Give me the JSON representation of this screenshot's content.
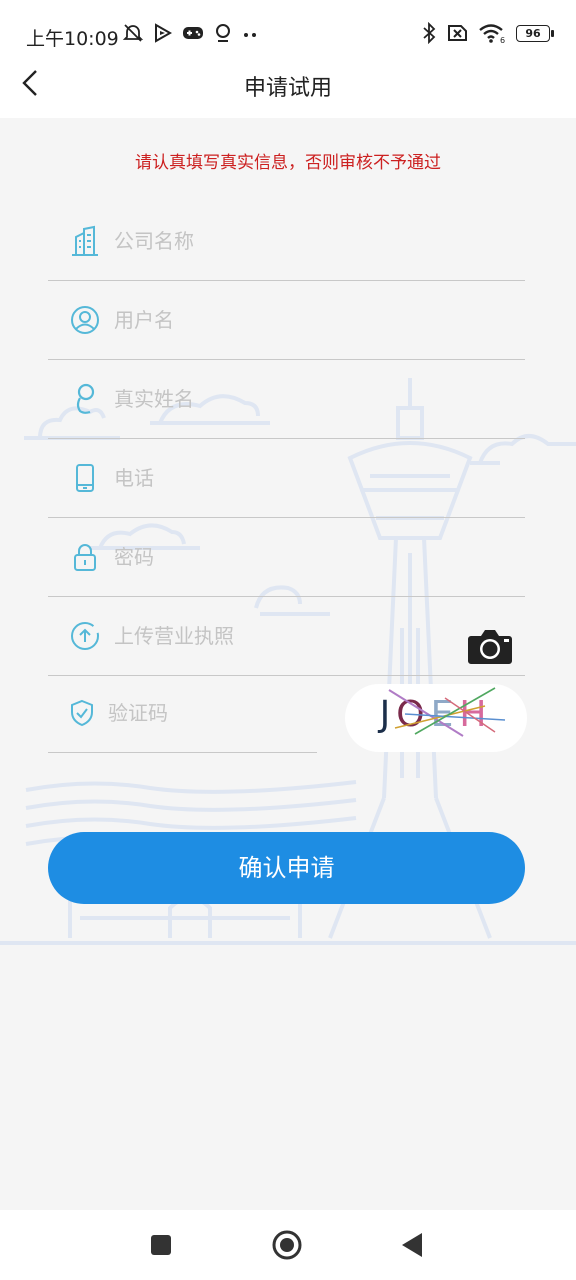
{
  "status_bar": {
    "time": "上午10:09",
    "battery": "96",
    "icons_left": [
      "mute-bell-icon",
      "media-icon",
      "gamepad-icon",
      "location-pin-icon",
      "more-dots-icon"
    ],
    "icons_right": [
      "bluetooth-icon",
      "no-sim-icon",
      "wifi-icon",
      "battery-icon"
    ]
  },
  "header": {
    "title": "申请试用"
  },
  "form": {
    "notice": "请认真填写真实信息，否则审核不予通过",
    "company_placeholder": "公司名称",
    "username_placeholder": "用户名",
    "realname_placeholder": "真实姓名",
    "phone_placeholder": "电话",
    "password_placeholder": "密码",
    "license_placeholder": "上传营业执照",
    "captcha_placeholder": "验证码",
    "captcha_letters": [
      "J",
      "O",
      "E",
      "H"
    ],
    "captcha_colors": [
      "#1c2f4a",
      "#7a2a4a",
      "#8fa9c7",
      "#d76a9c"
    ],
    "submit_label": "确认申请"
  },
  "colors": {
    "accent": "#1e8de3",
    "warning": "#cc2020",
    "icon": "#55b8d8"
  },
  "navbar": {
    "buttons": [
      "recent-apps-icon",
      "home-icon",
      "back-icon"
    ]
  }
}
